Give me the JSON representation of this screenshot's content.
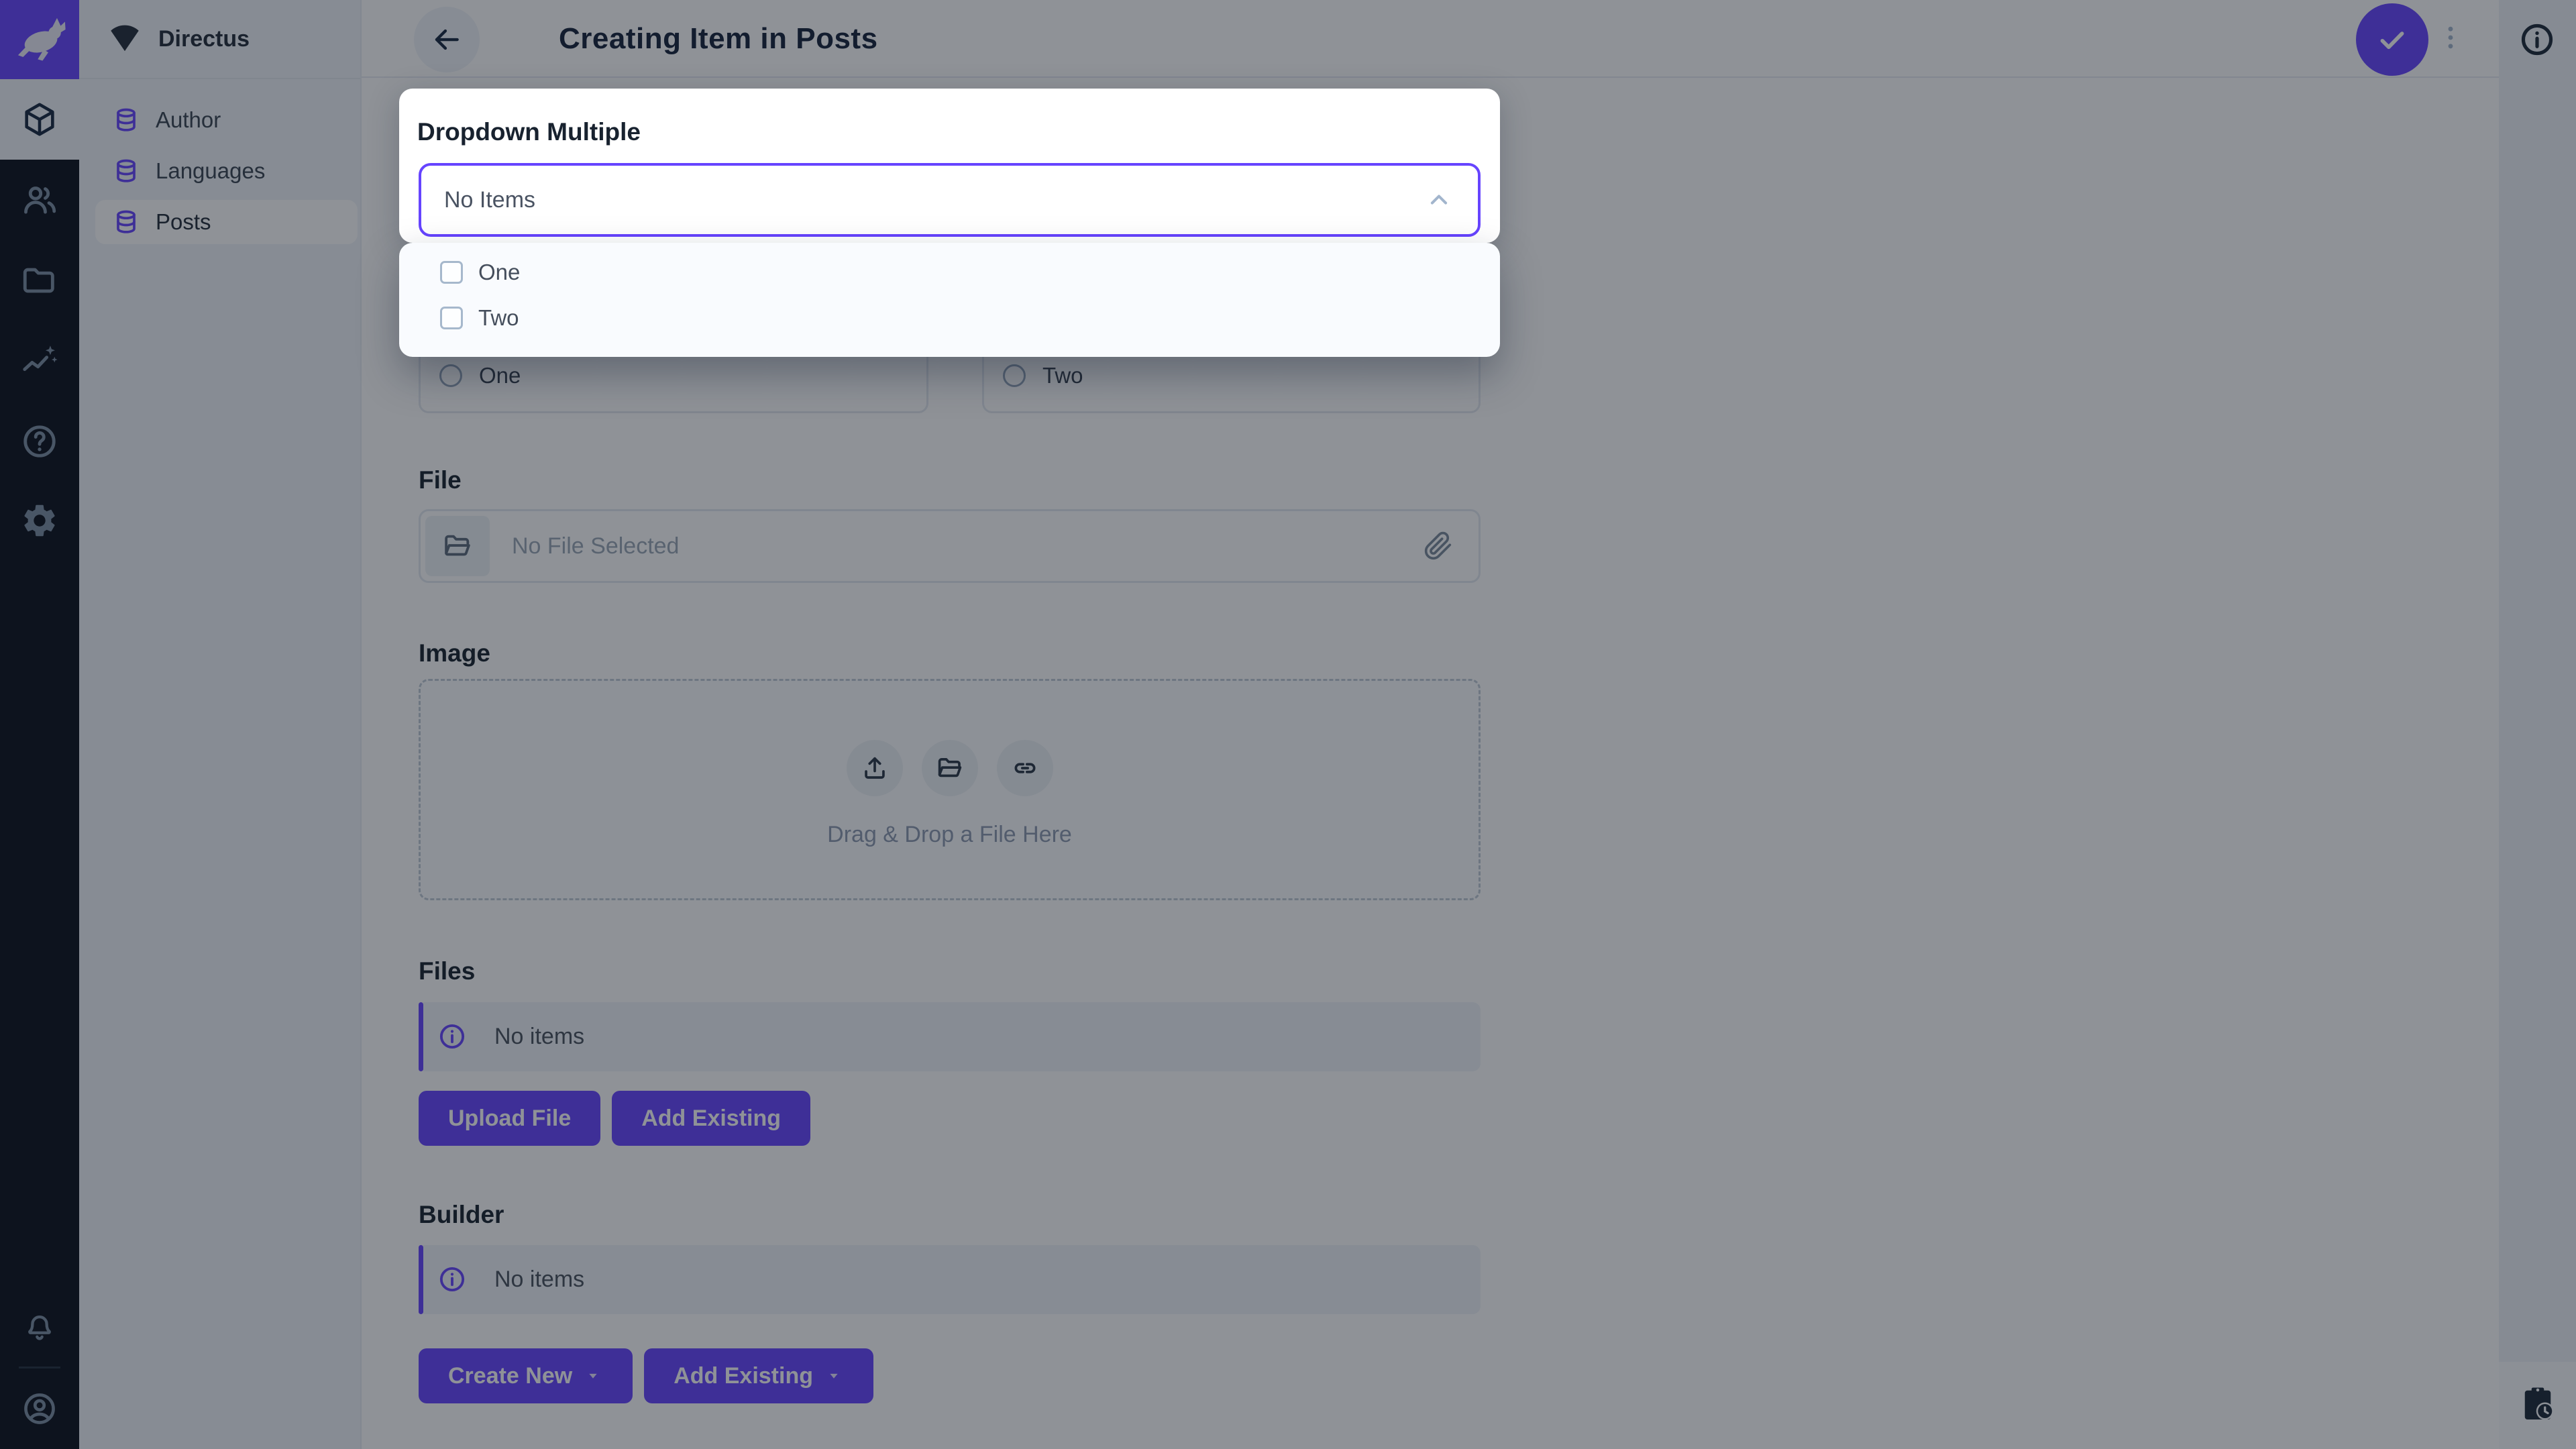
{
  "app": {
    "project_name": "Directus"
  },
  "header": {
    "title": "Creating Item in Posts"
  },
  "module_bar": {
    "modules": [
      {
        "name": "content",
        "icon": "box-icon",
        "active": true
      },
      {
        "name": "user-directory",
        "icon": "users-icon",
        "active": false
      },
      {
        "name": "file-library",
        "icon": "folder-icon",
        "active": false
      },
      {
        "name": "insights",
        "icon": "insights-icon",
        "active": false
      },
      {
        "name": "documentation",
        "icon": "help-icon",
        "active": false
      },
      {
        "name": "settings",
        "icon": "gear-icon",
        "active": false
      }
    ],
    "bottom": [
      {
        "name": "notifications",
        "icon": "bell-icon"
      },
      {
        "name": "account",
        "icon": "user-circle-icon"
      }
    ]
  },
  "sidebar": {
    "items": [
      {
        "label": "Author",
        "icon": "database-icon",
        "active": false
      },
      {
        "label": "Languages",
        "icon": "database-icon",
        "active": false
      },
      {
        "label": "Posts",
        "icon": "database-icon",
        "active": true
      }
    ]
  },
  "dropdown_modal": {
    "label": "Dropdown Multiple",
    "value": "No Items",
    "options": [
      {
        "label": "One",
        "checked": false
      },
      {
        "label": "Two",
        "checked": false
      }
    ]
  },
  "form": {
    "radio_group": {
      "options": [
        {
          "label": "One",
          "selected": false
        },
        {
          "label": "Two",
          "selected": false
        }
      ]
    },
    "file": {
      "label": "File",
      "placeholder": "No File Selected"
    },
    "image": {
      "label": "Image",
      "drop_text": "Drag & Drop a File Here"
    },
    "files": {
      "label": "Files",
      "empty_text": "No items",
      "upload_button": "Upload File",
      "add_button": "Add Existing"
    },
    "builder": {
      "label": "Builder",
      "empty_text": "No items",
      "create_button": "Create New",
      "add_button": "Add Existing"
    }
  },
  "colors": {
    "accent": "#6644FF",
    "module_bar_bg": "#0A101B",
    "sidebar_bg": "#F0F4F9",
    "overlay": "rgba(18,24,34,0.47)",
    "title": "#16233B",
    "placeholder": "#9AA7B5",
    "subdued_icon": "#A2B5CD"
  },
  "icons": {
    "logo": "rabbit",
    "project_status": "wedge",
    "save": "check",
    "options_menu": "more-vertical",
    "sidebar_info": "info-circle",
    "revisions": "clipboard-clock"
  }
}
